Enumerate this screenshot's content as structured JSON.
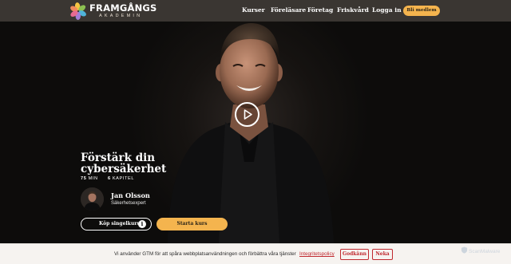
{
  "nav": {
    "logo_title": "FRAMGÅNGS",
    "logo_subtitle": "AKADEMIN",
    "links": [
      "Kurser",
      "Föreläsare",
      "Företag",
      "Friskvård",
      "Logga in"
    ],
    "cta_label": "Bli medlem"
  },
  "course": {
    "title": "Förstärk din cybersäkerhet",
    "duration_value": "75",
    "duration_unit": "MIN",
    "chapters_value": "6",
    "chapters_unit": "KAPITEL",
    "instructor_name": "Jan Olsson",
    "instructor_role": "Säkerhetsexpert",
    "buy_label": "Köp singelkurs",
    "buy_info_icon": "i",
    "start_label": "Starta kurs"
  },
  "cookie": {
    "text": "Vi använder GTM för att spåra webbplatsanvändningen och förbättra våra tjänster",
    "link": "Integritetspolicy",
    "accept": "Godkänn",
    "decline": "Neka"
  },
  "badge": {
    "text": "ScanMalware"
  },
  "colors": {
    "nav_bg": "#3a3632",
    "accent": "#f4b44e",
    "cookie_accent": "#c0292f",
    "logo_petals": [
      "#f08a5d",
      "#f4c542",
      "#8cc152",
      "#4fb3d9",
      "#a37ed8",
      "#e86a92"
    ]
  },
  "icons": [
    "framgangs-logo-icon",
    "play-icon",
    "info-icon",
    "scanmalware-icon"
  ]
}
